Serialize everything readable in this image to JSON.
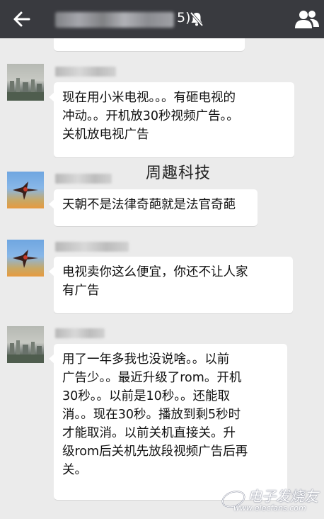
{
  "header": {
    "title_visible_tail": "5)",
    "back_icon": "arrow-left-icon",
    "mute_icon": "bell-muted-icon",
    "members_icon": "people-icon"
  },
  "messages": [
    {
      "avatar": "city-photo",
      "text": "现在用小米电视。。。有砸电视的\n冲动。。开机放30秒视频广告。。\n关机放电视广告"
    },
    {
      "avatar": "kite-photo",
      "text": "天朝不是法律奇葩就是法官奇葩"
    },
    {
      "avatar": "kite-photo",
      "text": "电视卖你这么便宜，你还不让人家\n有广告"
    },
    {
      "avatar": "city-photo",
      "text": "用了一年多我也没说啥。。以前\n广告少。。最近升级了rom。开机\n30秒。。以前是10秒。。还能取\n消。。现在30秒。播放到剩5秒时\n才能取消。以前关机直接关。升\n级rom后关机先放段视频广告后再\n关。"
    }
  ],
  "watermarks": {
    "center": "周趣科技",
    "logo_text": "电子发烧友",
    "logo_url": "www.elecfans.com"
  },
  "colors": {
    "header_bg": "#393a3f",
    "chat_bg": "#ebebeb",
    "bubble_bg": "#ffffff"
  }
}
